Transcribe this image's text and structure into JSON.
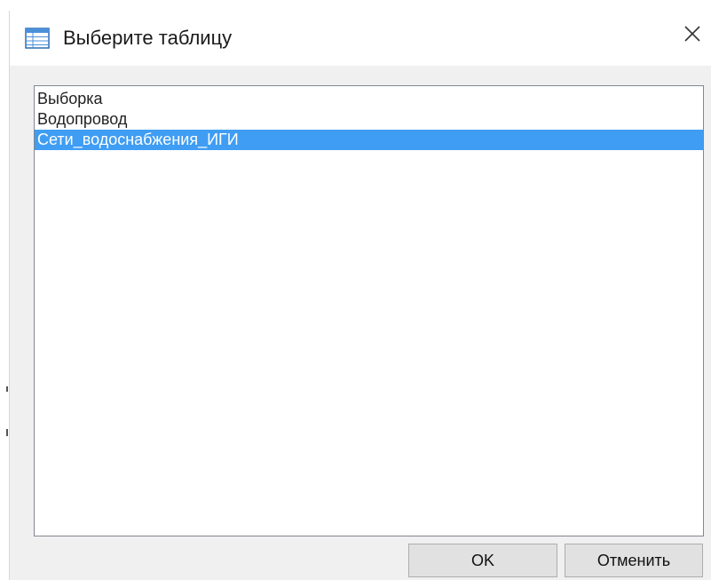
{
  "dialog": {
    "title": "Выберите таблицу",
    "title_icon": "table-icon",
    "close_icon": "close-icon"
  },
  "list": {
    "items": [
      {
        "label": "Выборка",
        "selected": false
      },
      {
        "label": "Водопровод",
        "selected": false
      },
      {
        "label": "Сети_водоснабжения_ИГИ",
        "selected": true
      }
    ]
  },
  "buttons": {
    "ok_label": "OK",
    "cancel_label": "Отменить"
  },
  "colors": {
    "selection": "#3f9df3",
    "dialog_bg": "#f0f0f0",
    "titlebar_bg": "#ffffff"
  }
}
